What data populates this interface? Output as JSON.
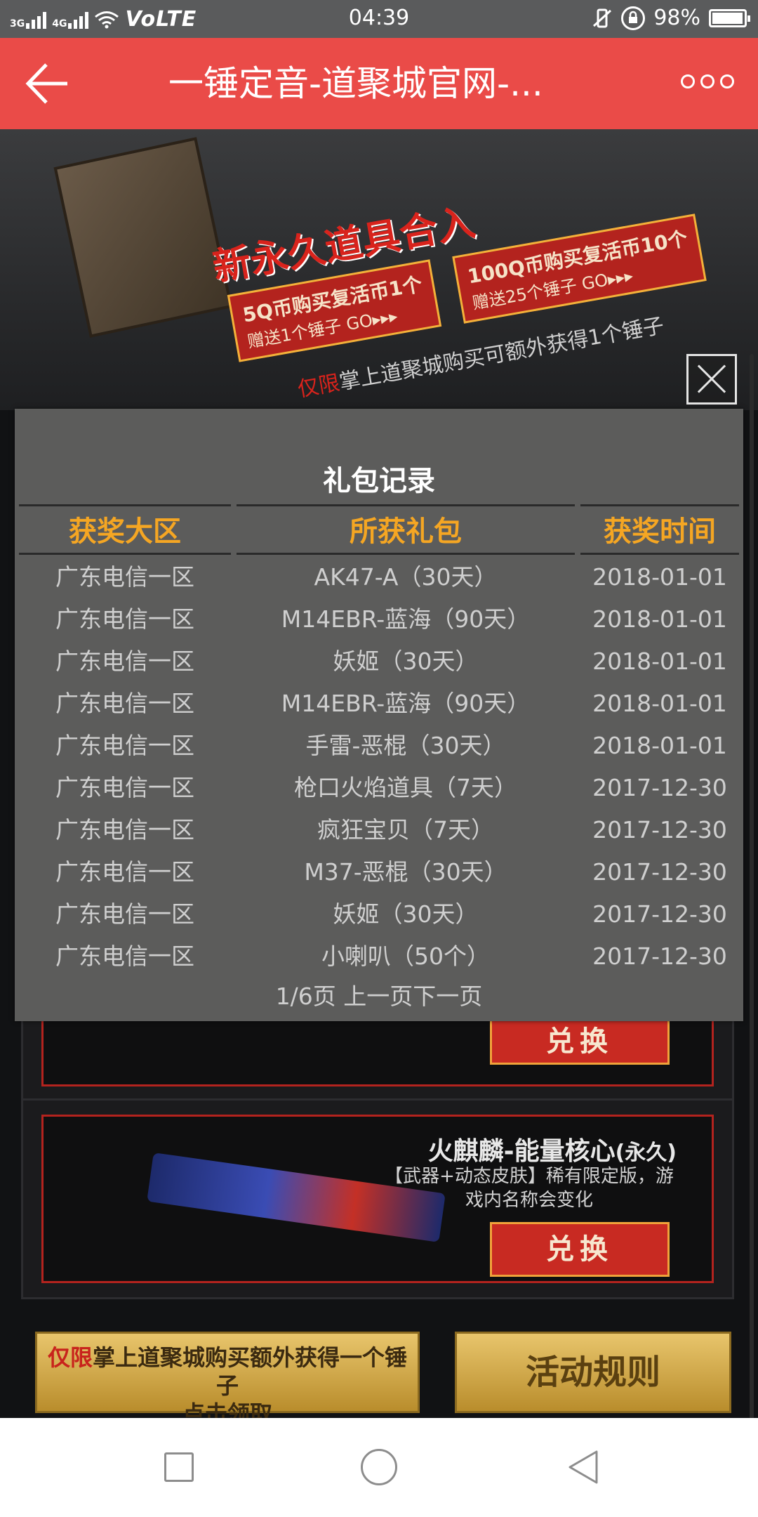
{
  "status_bar": {
    "network_1": "3G",
    "network_2": "4G",
    "volte": "VoLTE",
    "time": "04:39",
    "battery_percent": "98%",
    "battery_level": 0.98
  },
  "app_bar": {
    "title": "一锤定音-道聚城官网-..."
  },
  "background": {
    "banner_headline": "新永久道具合入",
    "promo_1_main": "5Q币购买复活币1个",
    "promo_1_sub": "赠送1个锤子",
    "promo_1_go": "GO▸▸▸",
    "promo_2_main": "100Q币购买复活币10个",
    "promo_2_sub": "赠送25个锤子",
    "promo_2_go": "GO▸▸▸",
    "note_red": "仅限",
    "note_rest": "掌上道聚城购买可额外获得1个锤子",
    "exchange_label_1": "兑换",
    "item_title": "火麒麟-能量核心",
    "item_title_suffix": "(永久)",
    "item_desc": "【武器+动态皮肤】稀有限定版，游戏内名称会变化",
    "exchange_label_2": "兑换",
    "claim_red": "仅限",
    "claim_rest": "掌上道聚城购买额外获得一个锤子",
    "claim_line2": "点击领取",
    "rules_label": "活动规则"
  },
  "modal": {
    "title": "礼包记录",
    "headers": {
      "region": "获奖大区",
      "gift": "所获礼包",
      "time": "获奖时间"
    },
    "rows": [
      {
        "region": "广东电信一区",
        "gift": "AK47-A（30天）",
        "time": "2018-01-01"
      },
      {
        "region": "广东电信一区",
        "gift": "M14EBR-蓝海（90天）",
        "time": "2018-01-01"
      },
      {
        "region": "广东电信一区",
        "gift": "妖姬（30天）",
        "time": "2018-01-01"
      },
      {
        "region": "广东电信一区",
        "gift": "M14EBR-蓝海（90天）",
        "time": "2018-01-01"
      },
      {
        "region": "广东电信一区",
        "gift": "手雷-恶棍（30天）",
        "time": "2018-01-01"
      },
      {
        "region": "广东电信一区",
        "gift": "枪口火焰道具（7天）",
        "time": "2017-12-30"
      },
      {
        "region": "广东电信一区",
        "gift": "疯狂宝贝（7天）",
        "time": "2017-12-30"
      },
      {
        "region": "广东电信一区",
        "gift": "M37-恶棍（30天）",
        "time": "2017-12-30"
      },
      {
        "region": "广东电信一区",
        "gift": "妖姬（30天）",
        "time": "2017-12-30"
      },
      {
        "region": "广东电信一区",
        "gift": "小喇叭（50个）",
        "time": "2017-12-30"
      }
    ],
    "pager": {
      "page_info": "1/6页",
      "prev": "上一页",
      "next": "下一页"
    }
  },
  "colors": {
    "app_bar": "#ea4b48",
    "modal_bg": "#5c5c5b",
    "header_text": "#f5a623"
  }
}
